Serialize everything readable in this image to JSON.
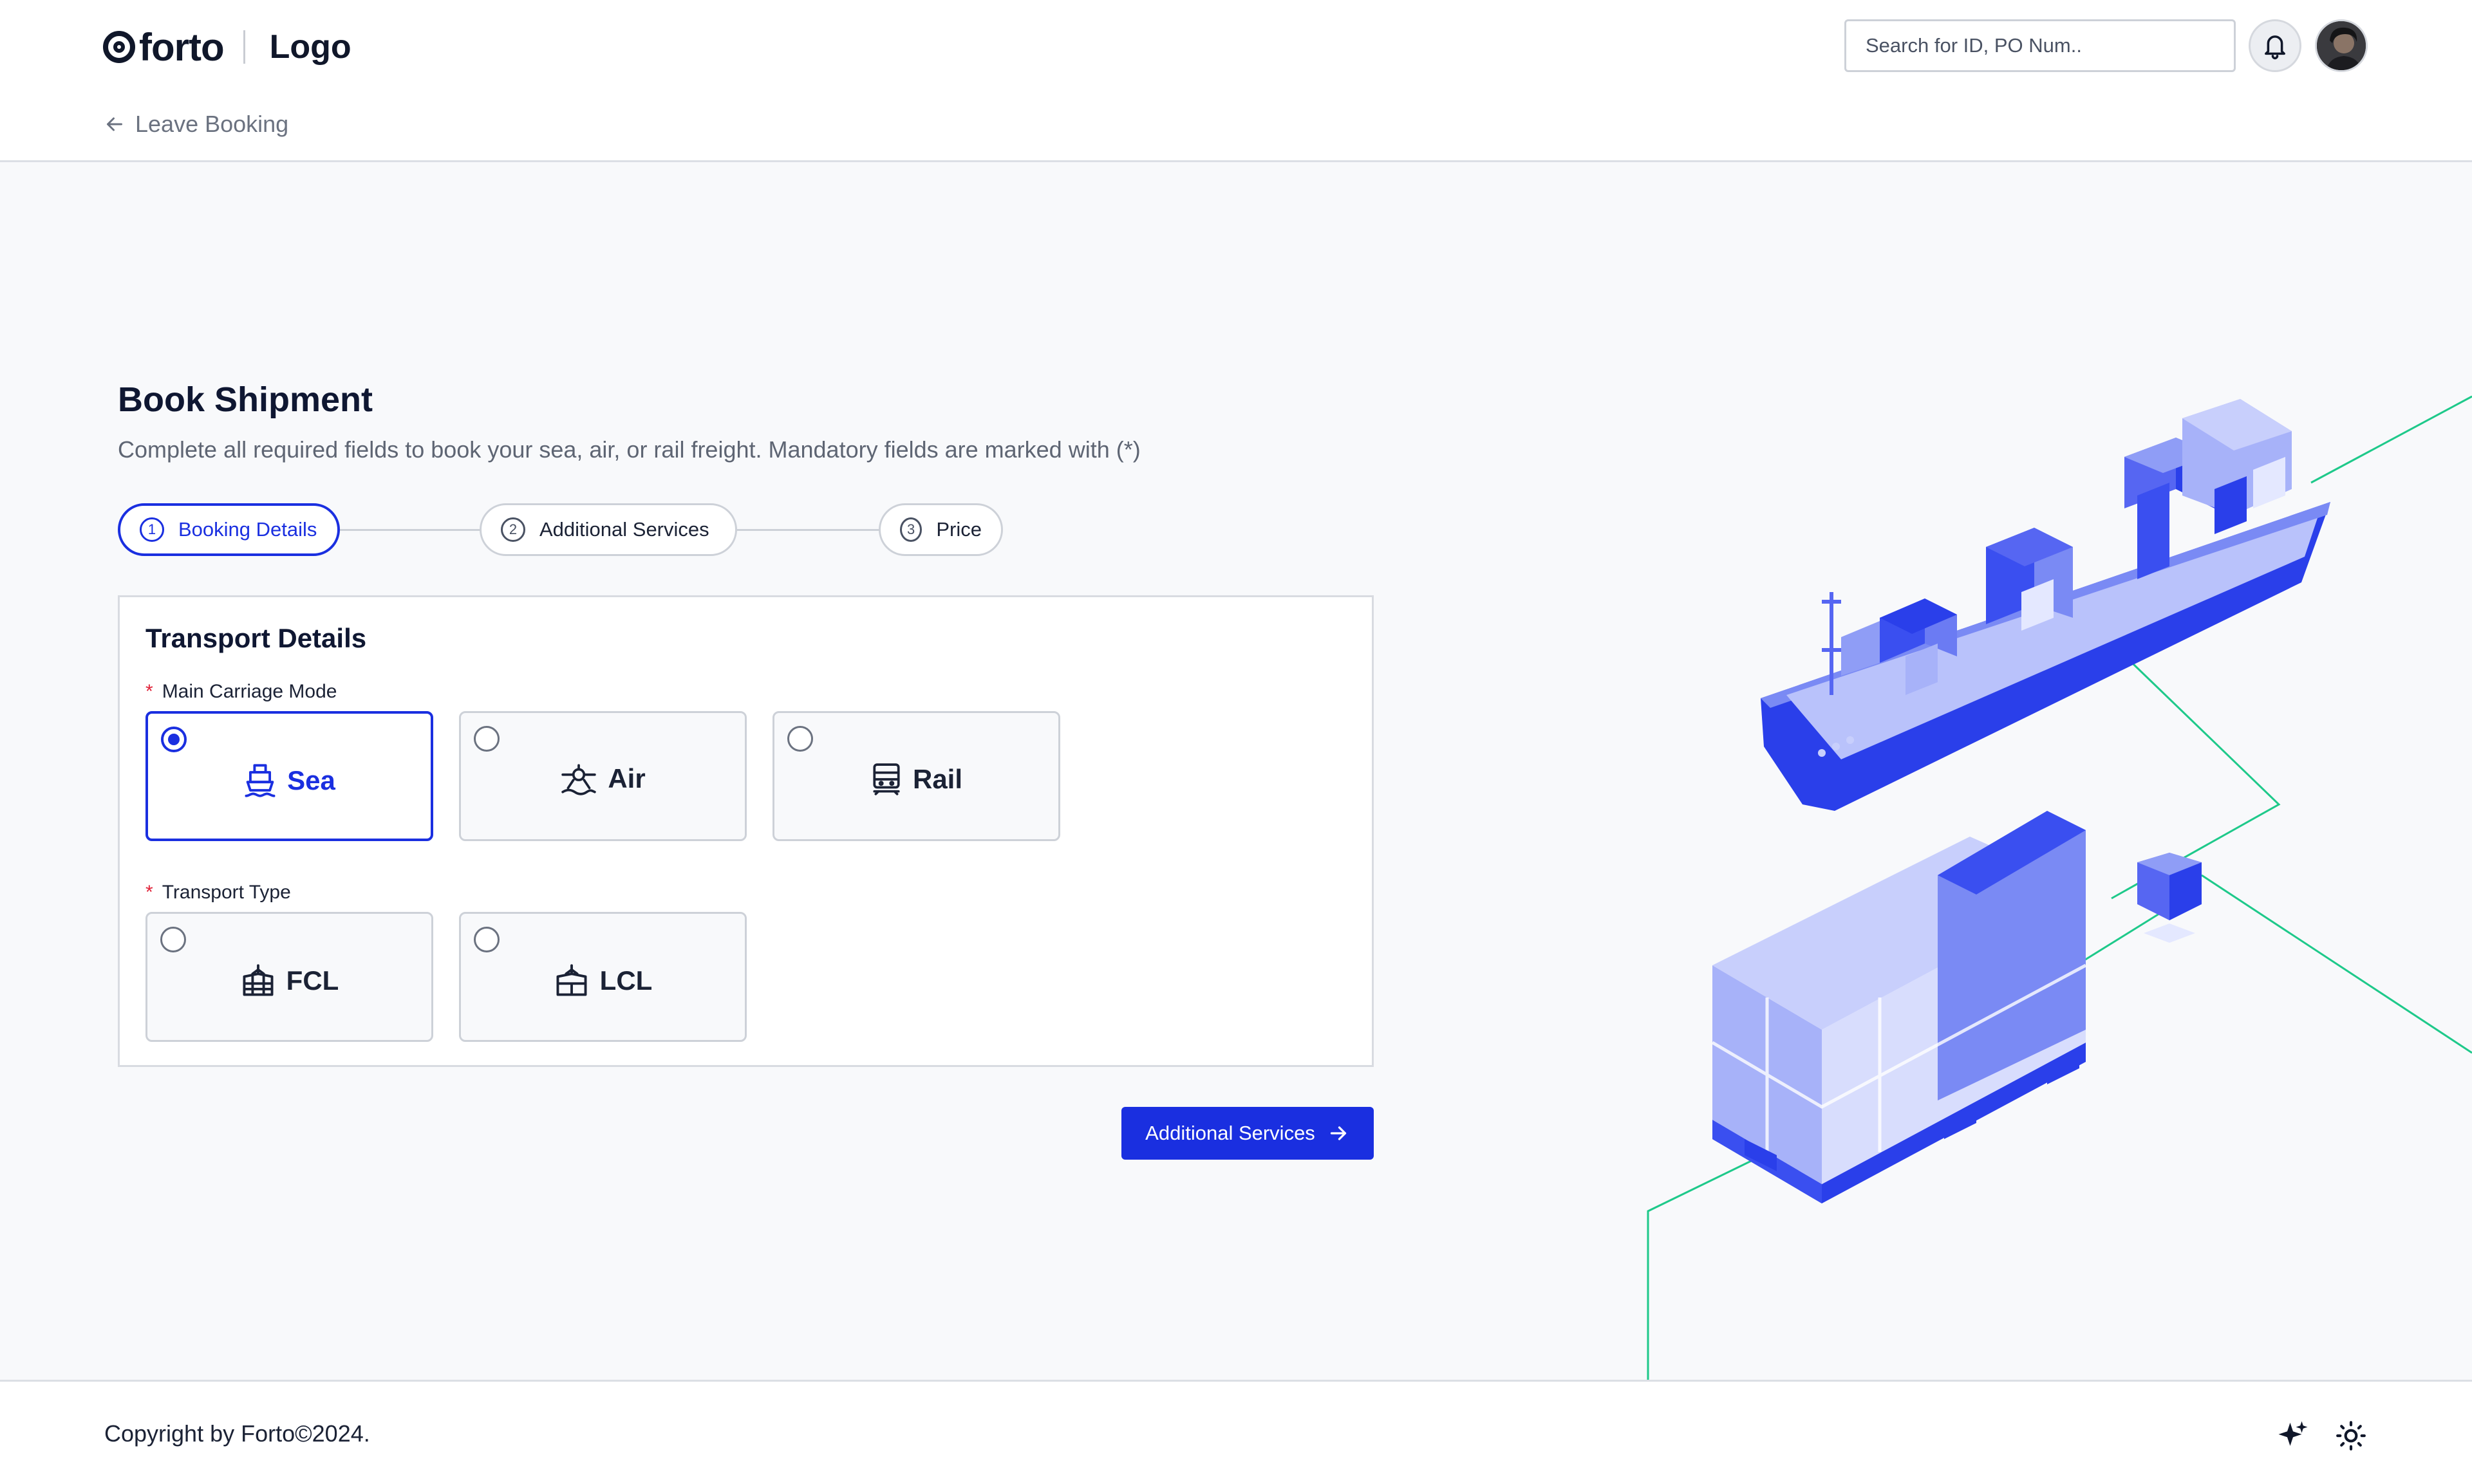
{
  "header": {
    "brand_name": "forto",
    "logo_text": "Logo",
    "search_placeholder": "Search for ID, PO Num..",
    "leave_label": "Leave Booking"
  },
  "main": {
    "title": "Book Shipment",
    "subtitle": "Complete all required fields to book your sea, air, or rail freight. Mandatory fields are marked with (*)",
    "steps": [
      {
        "num": "1",
        "label": "Booking Details",
        "active": true
      },
      {
        "num": "2",
        "label": "Additional Services",
        "active": false
      },
      {
        "num": "3",
        "label": "Price",
        "active": false
      }
    ],
    "card": {
      "title": "Transport Details",
      "carriage_label": "Main Carriage Mode",
      "carriage_options": [
        {
          "label": "Sea",
          "icon": "ship-icon",
          "selected": true
        },
        {
          "label": "Air",
          "icon": "airplane-icon",
          "selected": false
        },
        {
          "label": "Rail",
          "icon": "train-icon",
          "selected": false
        }
      ],
      "type_label": "Transport Type",
      "type_options": [
        {
          "label": "FCL",
          "icon": "container-icon",
          "selected": false
        },
        {
          "label": "LCL",
          "icon": "container-icon",
          "selected": false
        }
      ],
      "required_mark": "*"
    },
    "next_button": "Additional Services"
  },
  "footer": {
    "copyright": "Copyright by Forto©2024."
  },
  "colors": {
    "accent": "#1a2fe0",
    "required": "#e0243a",
    "illustration_line": "#1ec98a"
  }
}
